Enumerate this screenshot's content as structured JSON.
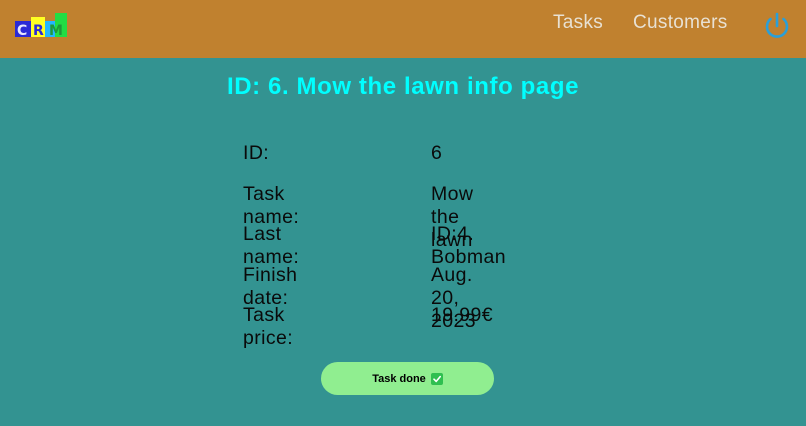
{
  "header": {
    "logo_text": "CRM",
    "nav": [
      {
        "label": "Tasks"
      },
      {
        "label": "Customers"
      }
    ],
    "logout_icon": "power-icon"
  },
  "page": {
    "title": "ID: 6. Mow the lawn info page"
  },
  "details": [
    {
      "label": "ID:",
      "value": "6"
    },
    {
      "label": "Task name:",
      "value": "Mow the lawn"
    },
    {
      "label": "Last name:",
      "value": "ID:4. Bobman"
    },
    {
      "label": "Finish date:",
      "value": "Aug. 20, 2023"
    },
    {
      "label": "Task price:",
      "value": "19.99€"
    }
  ],
  "action": {
    "done_label": "Task done",
    "done_icon": "check-box-icon"
  },
  "colors": {
    "header_bg": "#c0812f",
    "page_bg": "#339391",
    "title": "#00ffff",
    "button_bg": "#90ee90"
  }
}
